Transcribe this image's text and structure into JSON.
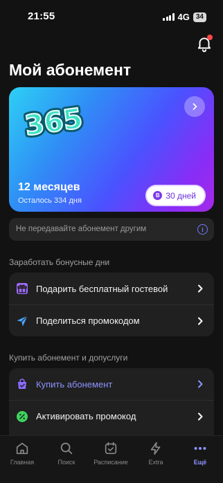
{
  "status": {
    "time": "21:55",
    "network": "4G",
    "battery": "34"
  },
  "header": {
    "title": "Мой абонемент"
  },
  "subscription": {
    "logo_text": "365",
    "period": "12 месяцев",
    "remaining": "Осталось 334 дня",
    "bonus_badge": "B",
    "bonus_days": "30 дней"
  },
  "warning": {
    "text": "Не передавайте абонемент другим"
  },
  "bonus_section": {
    "label": "Заработать бонусные дни",
    "items": [
      {
        "label": "Подарить бесплатный гостевой",
        "icon": "gift-icon"
      },
      {
        "label": "Поделиться промокодом",
        "icon": "send-icon"
      }
    ]
  },
  "buy_section": {
    "label": "Купить абонемент и допуслуги",
    "items": [
      {
        "label": "Купить абонемент",
        "icon": "shopping-bag-icon"
      },
      {
        "label": "Активировать промокод",
        "icon": "promo-icon"
      }
    ]
  },
  "tabbar": {
    "items": [
      {
        "label": "Главная",
        "icon": "home-icon"
      },
      {
        "label": "Поиск",
        "icon": "search-icon"
      },
      {
        "label": "Расписание",
        "icon": "calendar-icon"
      },
      {
        "label": "Extra",
        "icon": "lightning-icon"
      },
      {
        "label": "Ещё",
        "icon": "more-icon",
        "active": true
      }
    ]
  },
  "colors": {
    "accent": "#8c93ff",
    "background": "#121212",
    "notification_dot": "#ff4747"
  }
}
